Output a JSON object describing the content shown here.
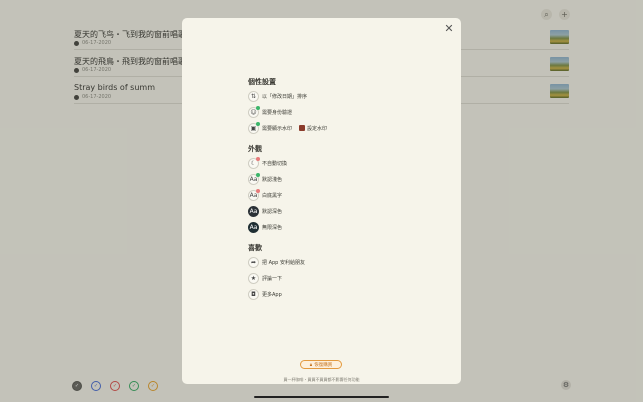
{
  "list": {
    "items": [
      {
        "title": "夏天的飞鸟・飞到我的窗前唱歌・又",
        "date": "06-17-2020"
      },
      {
        "title": "夏天的飛鳥・飛到我的窗前唱歌・又",
        "date": "06-17-2020"
      },
      {
        "title": "Stray birds of summ",
        "date": "06-17-2020"
      }
    ]
  },
  "top": {
    "search_icon": "search-icon",
    "add_icon": "plus-icon"
  },
  "bottom_colors": [
    "#5a5a55",
    "#4a6cd0",
    "#d9534f",
    "#3aa865",
    "#e0a030"
  ],
  "modal": {
    "sections": {
      "personal": {
        "title": "個性設置",
        "items": [
          {
            "label": "以「修改日期」排序",
            "icon": "sort-icon"
          },
          {
            "label": "需要身份驗證",
            "icon": "face-id-icon"
          },
          {
            "label": "需要顯示水印",
            "icon": "image-icon",
            "extra": "設定水印"
          }
        ]
      },
      "appearance": {
        "title": "外觀",
        "items": [
          {
            "label": "不自動切換",
            "icon": "moon-icon"
          },
          {
            "label": "默認淺色",
            "icon": "aa-icon"
          },
          {
            "label": "白底黑字",
            "icon": "aa-icon"
          },
          {
            "label": "默認深色",
            "icon": "aa-dark-icon"
          },
          {
            "label": "無限深色",
            "icon": "aa-darker-icon"
          }
        ]
      },
      "likes": {
        "title": "喜歡",
        "items": [
          {
            "label": "把 App 安利給朋友",
            "icon": "share-icon"
          },
          {
            "label": "評論一下",
            "icon": "star-icon"
          },
          {
            "label": "更多App",
            "icon": "app-icon"
          }
        ]
      }
    },
    "restore_label": "恢復購買",
    "footnote": "買一杯咖啡・買買不買買都不影響任何功能"
  }
}
